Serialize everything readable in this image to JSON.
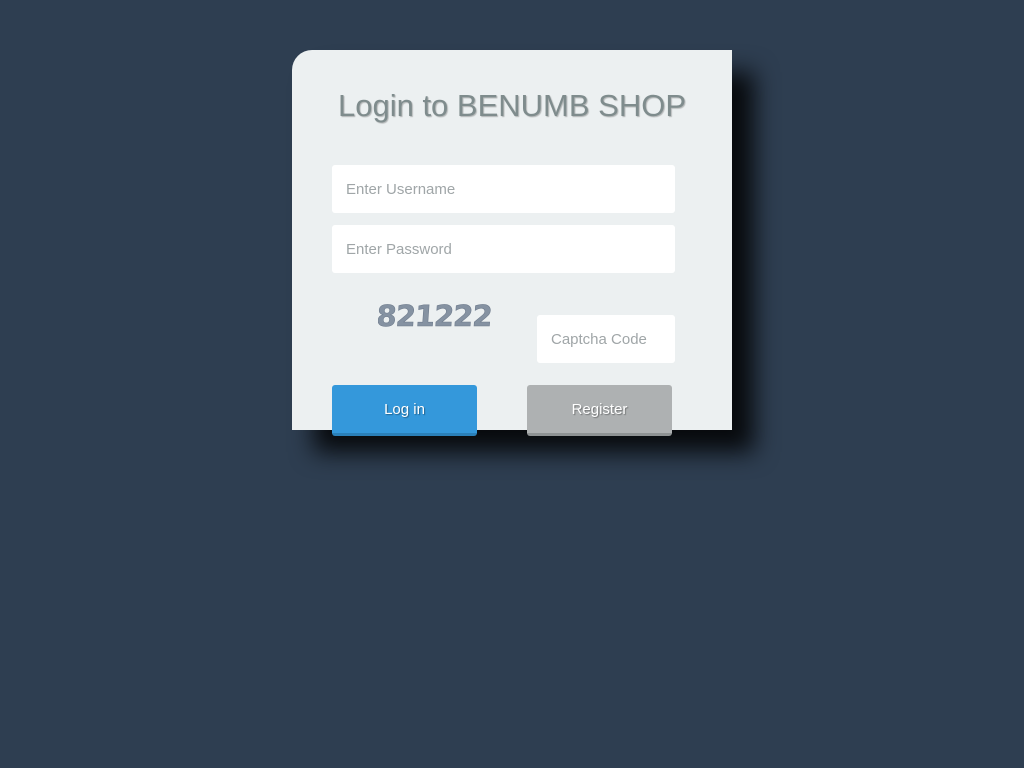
{
  "login": {
    "title": "Login to BENUMB SHOP",
    "username_placeholder": "Enter Username",
    "password_placeholder": "Enter Password",
    "captcha_text": "821222",
    "captcha_placeholder": "Captcha Code",
    "login_label": "Log in",
    "register_label": "Register"
  },
  "colors": {
    "background": "#2e3e51",
    "card": "#ecf0f1",
    "login_button": "#3498db",
    "register_button": "#aeb1b2",
    "title_text": "#7f8c8d",
    "captcha_text": "#8592a2"
  }
}
